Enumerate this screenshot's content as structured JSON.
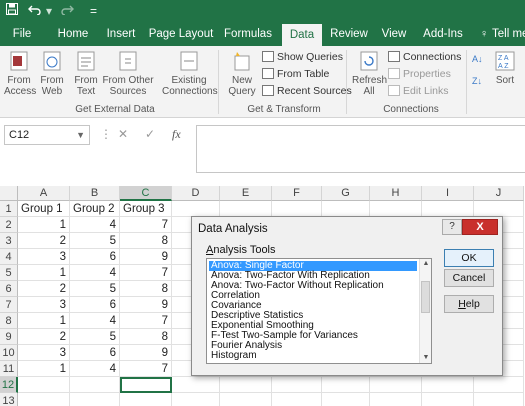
{
  "title_bar": {
    "save_icon": "save-icon",
    "undo_icon": "undo-icon",
    "redo_icon": "redo-icon",
    "customize": "="
  },
  "tabs": [
    {
      "label": "File"
    },
    {
      "label": "Home"
    },
    {
      "label": "Insert"
    },
    {
      "label": "Page Layout"
    },
    {
      "label": "Formulas"
    },
    {
      "label": "Data"
    },
    {
      "label": "Review"
    },
    {
      "label": "View"
    },
    {
      "label": "Add-Ins"
    },
    {
      "label": "Tell me"
    }
  ],
  "active_tab": "Data",
  "ribbon": {
    "from_access": "From\nAccess",
    "from_web": "From\nWeb",
    "from_text": "From\nText",
    "from_other": "From Other\nSources",
    "existing": "Existing\nConnections",
    "new_query": "New\nQuery",
    "show_queries": "Show Queries",
    "from_table": "From Table",
    "recent_sources": "Recent Sources",
    "refresh_all": "Refresh\nAll",
    "connections": "Connections",
    "properties": "Properties",
    "edit_links": "Edit Links",
    "sort": "Sort",
    "group_external": "Get External Data",
    "group_transform": "Get & Transform",
    "group_connections": "Connections"
  },
  "formula_bar": {
    "name_box": "C12",
    "cancel": "✕",
    "enter": "✓",
    "fx": "fx",
    "value": ""
  },
  "columns": [
    "A",
    "B",
    "C",
    "D",
    "E",
    "F",
    "G",
    "H",
    "I",
    "J"
  ],
  "rows": [
    "1",
    "2",
    "3",
    "4",
    "5",
    "6",
    "7",
    "8",
    "9",
    "10",
    "11",
    "12",
    "13"
  ],
  "cells": {
    "header": [
      "Group 1",
      "Group 2",
      "Group 3"
    ],
    "data": [
      [
        1,
        4,
        7
      ],
      [
        2,
        5,
        8
      ],
      [
        3,
        6,
        9
      ],
      [
        1,
        4,
        7
      ],
      [
        2,
        5,
        8
      ],
      [
        3,
        6,
        9
      ],
      [
        1,
        4,
        7
      ],
      [
        2,
        5,
        8
      ],
      [
        3,
        6,
        9
      ],
      [
        1,
        4,
        7
      ]
    ]
  },
  "dialog": {
    "title": "Data Analysis",
    "help": "?",
    "close": "X",
    "tools_label": "Analysis Tools",
    "tools": [
      "Anova: Single Factor",
      "Anova: Two-Factor With Replication",
      "Anova: Two-Factor Without Replication",
      "Correlation",
      "Covariance",
      "Descriptive Statistics",
      "Exponential Smoothing",
      "F-Test Two-Sample for Variances",
      "Fourier Analysis",
      "Histogram"
    ],
    "selected_tool": "Anova: Single Factor",
    "ok": "OK",
    "cancel": "Cancel",
    "help_button": "Help"
  },
  "colors": {
    "brand": "#217346",
    "selection": "#3399ff"
  }
}
